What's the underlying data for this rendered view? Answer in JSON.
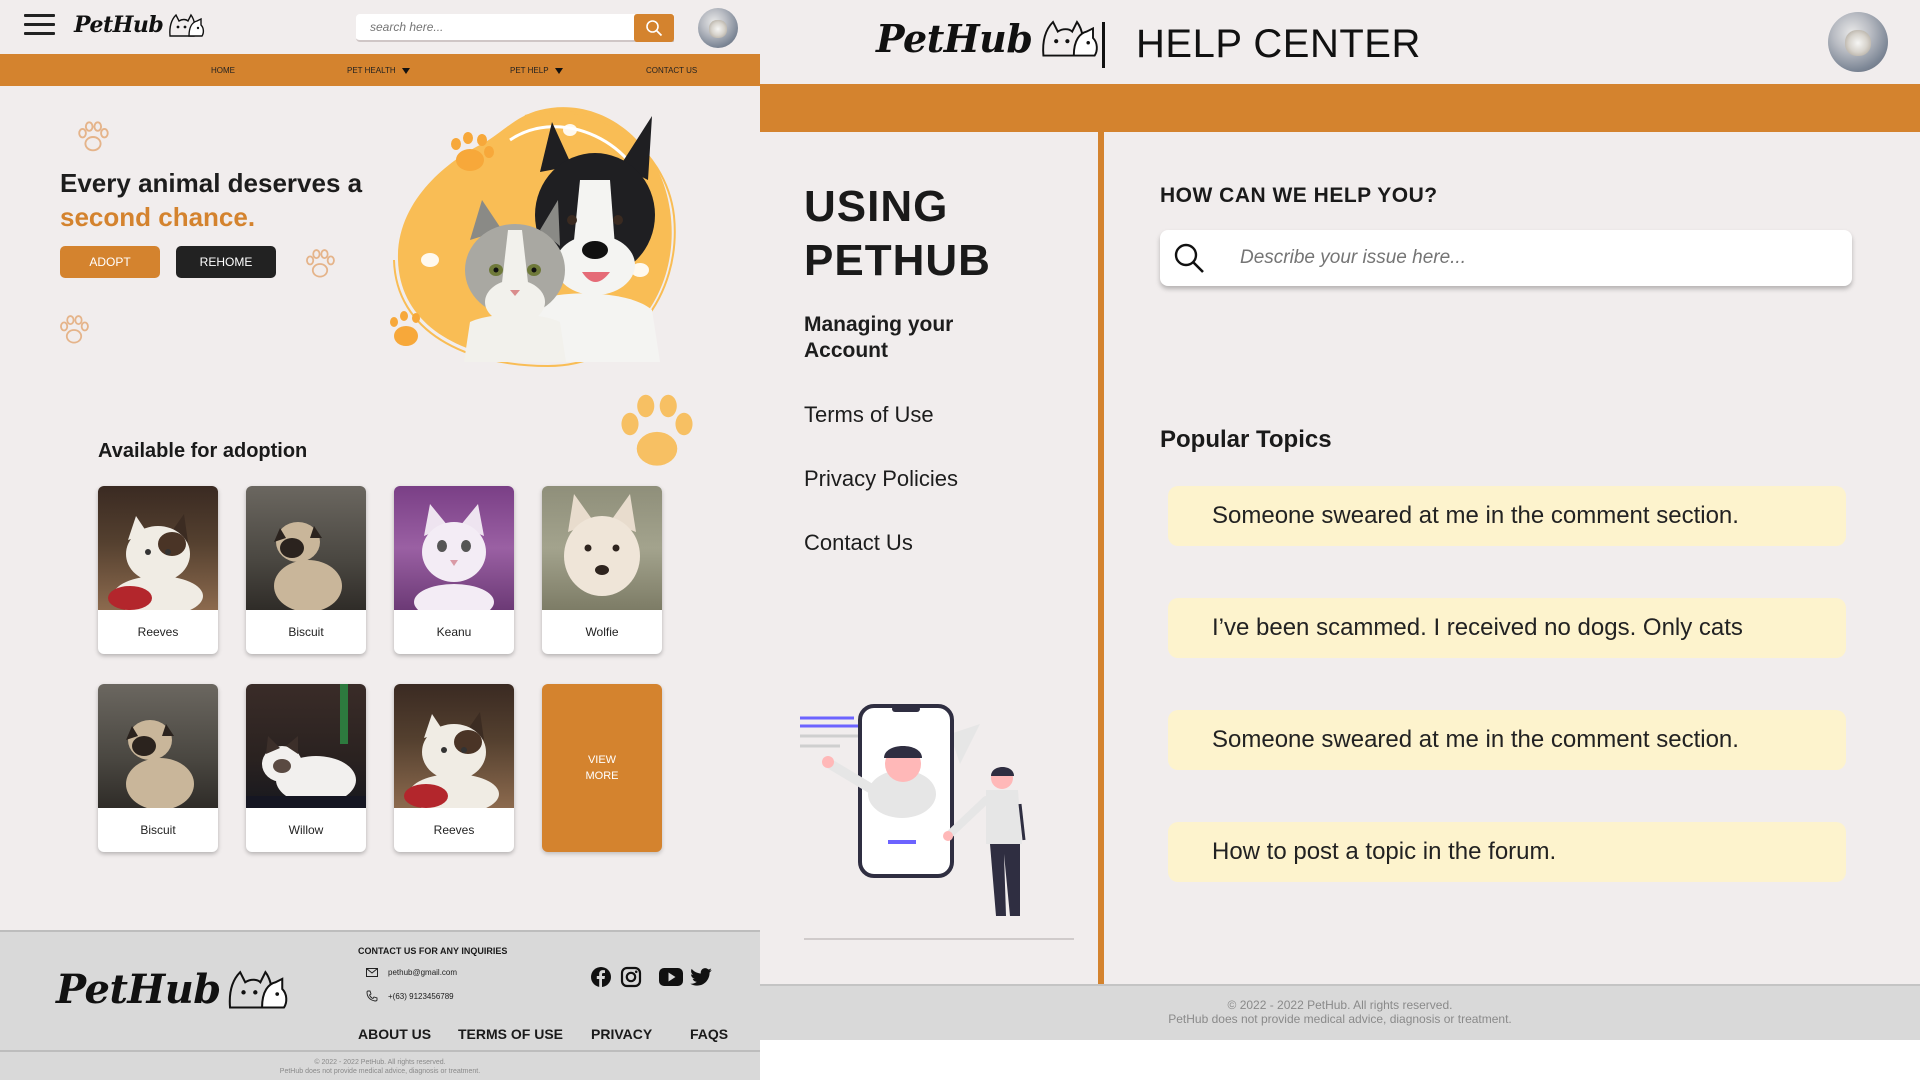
{
  "left": {
    "header": {
      "logo_text": "PetHub",
      "search_placeholder": "search here..."
    },
    "nav": {
      "home": "HOME",
      "pet_health": "PET HEALTH",
      "pet_help": "PET HELP",
      "contact": "CONTACT US"
    },
    "hero": {
      "title_line1": "Every animal deserves a",
      "title_accent": "second chance.",
      "adopt_label": "ADOPT",
      "rehome_label": "REHOME"
    },
    "adoption": {
      "title": "Available for adoption",
      "pets": [
        {
          "name": "Reeves"
        },
        {
          "name": "Biscuit"
        },
        {
          "name": "Keanu"
        },
        {
          "name": "Wolfie"
        },
        {
          "name": "Biscuit"
        },
        {
          "name": "Willow"
        },
        {
          "name": "Reeves"
        }
      ],
      "view_more_line1": "VIEW",
      "view_more_line2": "MORE"
    },
    "footer": {
      "logo_text": "PetHub",
      "contact_title": "CONTACT US FOR ANY INQUIRIES",
      "email": "pethub@gmail.com",
      "phone": "+(63) 9123456789",
      "links": {
        "about": "ABOUT US",
        "terms": "TERMS OF USE",
        "privacy": "PRIVACY",
        "faqs": "FAQS"
      },
      "copyright_line1": "© 2022 - 2022 PetHub. All rights reserved.",
      "copyright_line2": "PetHub does not provide medical advice, diagnosis or treatment."
    }
  },
  "right": {
    "header": {
      "logo_text": "PetHub",
      "title": "HELP CENTER"
    },
    "sidebar": {
      "heading_line1": "USING",
      "heading_line2": "PETHUB",
      "active_line1": "Managing your",
      "active_line2": "Account",
      "links": [
        "Terms of Use",
        "Privacy Policies",
        "Contact Us"
      ]
    },
    "main": {
      "question": "HOW CAN WE HELP YOU?",
      "search_placeholder": "Describe your issue here...",
      "popular_title": "Popular Topics",
      "topics": [
        "Someone sweared at me in the comment section.",
        "I’ve been scammed. I received no dogs. Only cats",
        "Someone sweared at me in the comment section.",
        "How to post a topic in the forum."
      ]
    },
    "footer": {
      "line1": "© 2022 - 2022 PetHub. All rights reserved.",
      "line2": "PetHub does not provide medical advice, diagnosis or treatment."
    }
  },
  "colors": {
    "accent": "#d4832e",
    "background": "#f1eded",
    "topic_bg": "#fdf3cd",
    "dark": "#222222"
  },
  "icons": [
    "menu-icon",
    "search-icon",
    "paw-icon",
    "mail-icon",
    "phone-icon",
    "facebook-icon",
    "instagram-icon",
    "youtube-icon",
    "twitter-icon",
    "dog-cat-logo-icon"
  ]
}
